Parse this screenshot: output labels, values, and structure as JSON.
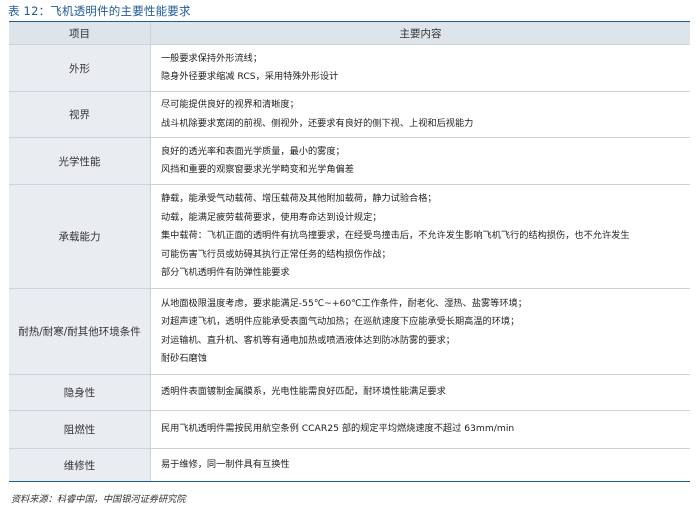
{
  "caption": "表 12：飞机透明件的主要性能要求",
  "table": {
    "headers": [
      "项目",
      "主要内容"
    ],
    "rows": [
      {
        "item": "外形",
        "lines": [
          "一般要求保持外形流线；",
          "隐身外径要求缩减 RCS，采用特殊外形设计"
        ]
      },
      {
        "item": "视界",
        "lines": [
          "尽可能提供良好的视界和清晰度；",
          "战斗机除要求宽阔的前视、侧视外，还要求有良好的侧下视、上视和后视能力"
        ]
      },
      {
        "item": "光学性能",
        "lines": [
          "良好的透光率和表面光学质量，最小的雾度；",
          "风挡和重要的观察窗要求光学畸变和光学角偏差"
        ]
      },
      {
        "item": "承载能力",
        "lines": [
          "静载，能承受气动载荷、增压载荷及其他附加载荷，静力试验合格；",
          "动载，能满足疲劳载荷要求，使用寿命达到设计规定；",
          "集中载荷：飞机正面的透明件有抗鸟撞要求，在经受鸟撞击后，不允许发生影响飞机飞行的结构损伤，也不允许发生",
          "可能伤害飞行员或妨碍其执行正常任务的结构损伤作战；",
          "部分飞机透明件有防弹性能要求"
        ]
      },
      {
        "item": "耐热/耐寒/耐其他环境条件",
        "lines": [
          "从地面极限温度考虑，要求能满足-55℃~+60℃工作条件，耐老化、湿热、盐雾等环境；",
          "对超声速飞机，透明件应能承受表面气动加热；在巡航速度下应能承受长期高温的环境；",
          "对运输机、直升机、客机等有通电加热或喷洒液体达到防冰防雾的要求；",
          "耐砂石磨蚀"
        ]
      },
      {
        "item": "隐身性",
        "lines": [
          "透明件表面镀制金属膜系，光电性能需良好匹配，耐环境性能满足要求"
        ]
      },
      {
        "item": "阻燃性",
        "lines": [
          "民用飞机透明件需按民用航空条例 CCAR25 部的规定平均燃烧速度不超过 63mm/min"
        ]
      },
      {
        "item": "维修性",
        "lines": [
          "易于维修，同一制件具有互换性"
        ]
      }
    ]
  },
  "source": "资料来源：科睿中国，中国银河证券研究院"
}
